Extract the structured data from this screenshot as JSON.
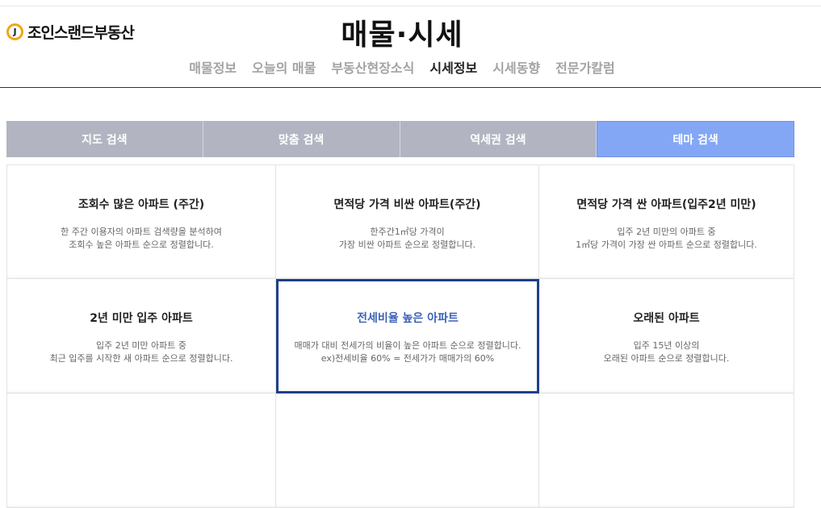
{
  "logo": {
    "mark": "J",
    "text": "조인스랜드부동산"
  },
  "page_title": "매물·시세",
  "subnav": [
    {
      "label": "매물정보",
      "active": false
    },
    {
      "label": "오늘의 매물",
      "active": false
    },
    {
      "label": "부동산현장소식",
      "active": false
    },
    {
      "label": "시세정보",
      "active": true
    },
    {
      "label": "시세동향",
      "active": false
    },
    {
      "label": "전문가칼럼",
      "active": false
    }
  ],
  "tabs": [
    {
      "label": "지도 검색",
      "active": false
    },
    {
      "label": "맞춤 검색",
      "active": false
    },
    {
      "label": "역세권 검색",
      "active": false
    },
    {
      "label": "테마 검색",
      "active": true
    }
  ],
  "cards": [
    {
      "title": "조회수 많은 아파트 (주간)",
      "lines": [
        "한 주간 이용자의 아파트 검색량을 분석하여",
        "조회수 높은 아파트 순으로 정렬합니다."
      ]
    },
    {
      "title": "면적당 가격 비싼 아파트(주간)",
      "lines": [
        "한주간1㎡당 가격이",
        "가장 비싼 아파트 순으로 정렬합니다."
      ]
    },
    {
      "title": "면적당 가격 싼 아파트(입주2년 미만)",
      "lines": [
        "입주 2년 미만의 아파트 중",
        "1㎡당 가격이 가장 싼 아파트 순으로 정렬합니다."
      ]
    },
    {
      "title": "2년 미만 입주 아파트",
      "lines": [
        "입주 2년 미만 아파트 중",
        "최근 입주를 시작한 새 아파트 순으로 정렬합니다."
      ]
    },
    {
      "title": "전세비율 높은 아파트",
      "lines": [
        "매매가 대비 전세가의 비율이 높은 아파트 순으로 정렬합니다.",
        "ex)전세비율 60% = 전세가가 매매가의 60%"
      ],
      "selected": true
    },
    {
      "title": "오래된 아파트",
      "lines": [
        "입주 15년 이상의",
        "오래된 아파트 순으로 정렬합니다."
      ]
    },
    {
      "title": "",
      "lines": []
    },
    {
      "title": "",
      "lines": []
    },
    {
      "title": "",
      "lines": []
    }
  ],
  "colors": {
    "logo_ring": "#f2a516",
    "tab_default": "#b2b5c1",
    "tab_active": "#84a7f5",
    "selected_border": "#1e3f8a",
    "selected_title": "#3d62b8"
  }
}
